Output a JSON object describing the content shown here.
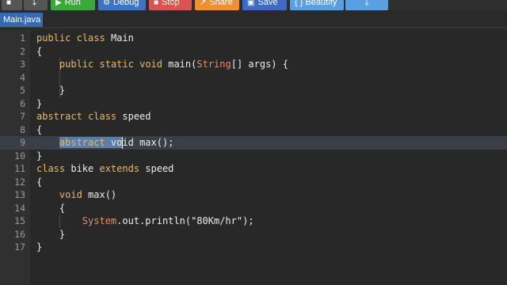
{
  "toolbar": {
    "buttons": [
      {
        "label": "",
        "icon": "file-icon",
        "color": "#5a5a5a"
      },
      {
        "label": "",
        "icon": "fork-icon",
        "color": "#5a5a5a"
      },
      {
        "label": "Run",
        "icon": "play-icon",
        "color": "#3aa83a"
      },
      {
        "label": "Debug",
        "icon": "debug-icon",
        "color": "#3d74c4"
      },
      {
        "label": "Stop",
        "icon": "stop-icon",
        "color": "#d9534f"
      },
      {
        "label": "Share",
        "icon": "share-icon",
        "color": "#ef8f2f"
      },
      {
        "label": "Save",
        "icon": "save-icon",
        "color": "#3d6bc4"
      },
      {
        "label": "{ } Beautify",
        "icon": "",
        "color": "#5aa0e0"
      },
      {
        "label": "",
        "icon": "download-icon",
        "color": "#5aa0e0"
      }
    ]
  },
  "tab": {
    "label": "Main.java"
  },
  "editor": {
    "lines": [
      {
        "n": "1",
        "code": "public class Main"
      },
      {
        "n": "2",
        "code": "{"
      },
      {
        "n": "3",
        "code": "    public static void main(String[] args) {"
      },
      {
        "n": "4",
        "code": ""
      },
      {
        "n": "5",
        "code": "    }"
      },
      {
        "n": "6",
        "code": "}"
      },
      {
        "n": "7",
        "code": "abstract class speed"
      },
      {
        "n": "8",
        "code": "{"
      },
      {
        "n": "9",
        "code": "    abstract void max();"
      },
      {
        "n": "10",
        "code": "}"
      },
      {
        "n": "11",
        "code": "class bike extends speed"
      },
      {
        "n": "12",
        "code": "{"
      },
      {
        "n": "13",
        "code": "    void max()"
      },
      {
        "n": "14",
        "code": "    {"
      },
      {
        "n": "15",
        "code": "        System.out.println(\"80Km/hr\");"
      },
      {
        "n": "16",
        "code": "    }"
      },
      {
        "n": "17",
        "code": "}"
      }
    ]
  },
  "colors": {
    "keyword": "#e8b96a",
    "type": "#e3906a",
    "tab": "#3569b4",
    "background": "#282828"
  }
}
